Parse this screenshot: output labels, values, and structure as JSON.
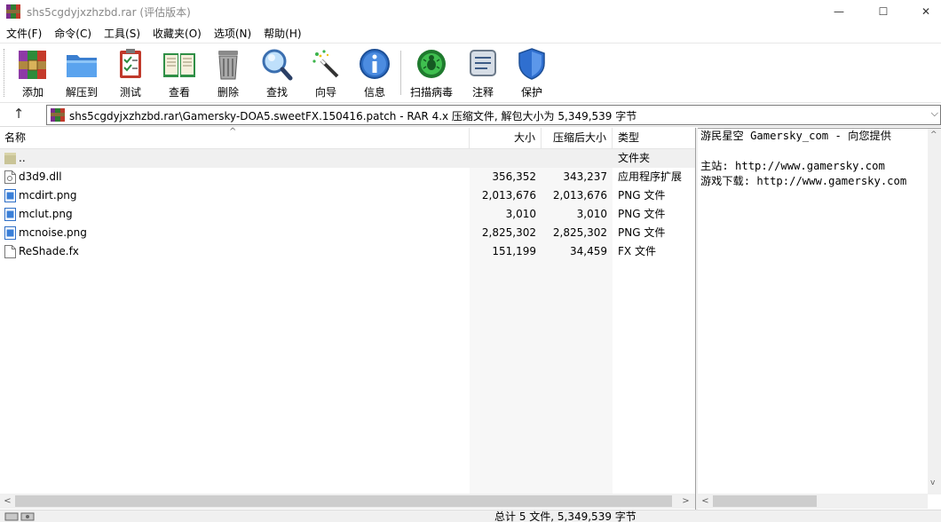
{
  "window": {
    "title": "shs5cgdyjxzhzbd.rar (评估版本)",
    "minimize": "—",
    "maximize": "☐",
    "close": "✕"
  },
  "menu": [
    "文件(F)",
    "命令(C)",
    "工具(S)",
    "收藏夹(O)",
    "选项(N)",
    "帮助(H)"
  ],
  "toolbar": [
    {
      "label": "添加",
      "icon": "add-archive-icon"
    },
    {
      "label": "解压到",
      "icon": "extract-folder-icon"
    },
    {
      "label": "测试",
      "icon": "test-clipboard-icon"
    },
    {
      "label": "查看",
      "icon": "view-book-icon"
    },
    {
      "label": "删除",
      "icon": "trash-icon"
    },
    {
      "label": "查找",
      "icon": "magnifier-icon"
    },
    {
      "label": "向导",
      "icon": "wizard-wand-icon"
    },
    {
      "label": "信息",
      "icon": "info-icon"
    },
    {
      "label": "扫描病毒",
      "icon": "virus-scan-icon"
    },
    {
      "label": "注释",
      "icon": "comment-icon"
    },
    {
      "label": "保护",
      "icon": "shield-icon"
    }
  ],
  "address": {
    "up": "↑",
    "path": "shs5cgdyjxzhzbd.rar\\Gamersky-DOA5.sweetFX.150416.patch - RAR 4.x 压缩文件, 解包大小为 5,349,539 字节",
    "chevron": "⌵"
  },
  "columns": {
    "name": "名称",
    "size": "大小",
    "packed": "压缩后大小",
    "type": "类型",
    "sort": "^"
  },
  "files": [
    {
      "name": "..",
      "size": "",
      "packed": "",
      "type": "文件夹",
      "icon": "parent-folder-icon"
    },
    {
      "name": "d3d9.dll",
      "size": "356,352",
      "packed": "343,237",
      "type": "应用程序扩展",
      "icon": "dll-file-icon"
    },
    {
      "name": "mcdirt.png",
      "size": "2,013,676",
      "packed": "2,013,676",
      "type": "PNG 文件",
      "icon": "png-file-icon"
    },
    {
      "name": "mclut.png",
      "size": "3,010",
      "packed": "3,010",
      "type": "PNG 文件",
      "icon": "png-file-icon"
    },
    {
      "name": "mcnoise.png",
      "size": "2,825,302",
      "packed": "2,825,302",
      "type": "PNG 文件",
      "icon": "png-file-icon"
    },
    {
      "name": "ReShade.fx",
      "size": "151,199",
      "packed": "34,459",
      "type": "FX 文件",
      "icon": "fx-file-icon"
    }
  ],
  "comment": {
    "lines": [
      "游民星空 Gamersky_com - 向您提供",
      "",
      "主站: http://www.gamersky.com",
      "游戏下载: http://www.gamersky.com"
    ]
  },
  "scroll": {
    "left": "<",
    "right": ">",
    "up": "^",
    "down": "v"
  },
  "status": {
    "text": "总计 5 文件, 5,349,539 字节"
  }
}
